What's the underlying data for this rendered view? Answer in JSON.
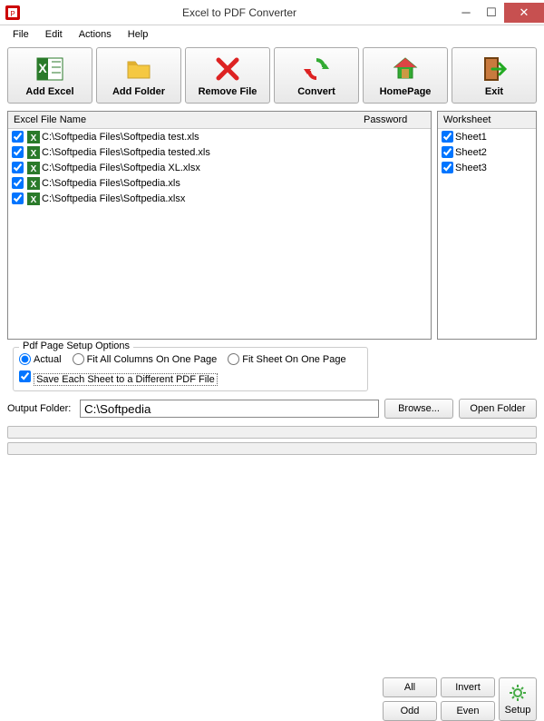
{
  "window": {
    "title": "Excel to PDF Converter"
  },
  "menubar": [
    "File",
    "Edit",
    "Actions",
    "Help"
  ],
  "toolbar": {
    "add_excel": "Add Excel",
    "add_folder": "Add Folder",
    "remove_file": "Remove File",
    "convert": "Convert",
    "homepage": "HomePage",
    "exit": "Exit"
  },
  "file_panel": {
    "header_name": "Excel File Name",
    "header_password": "Password",
    "files": [
      {
        "checked": true,
        "path": "C:\\Softpedia Files\\Softpedia test.xls"
      },
      {
        "checked": true,
        "path": "C:\\Softpedia Files\\Softpedia tested.xls"
      },
      {
        "checked": true,
        "path": "C:\\Softpedia Files\\Softpedia XL.xlsx"
      },
      {
        "checked": true,
        "path": "C:\\Softpedia Files\\Softpedia.xls"
      },
      {
        "checked": true,
        "path": "C:\\Softpedia Files\\Softpedia.xlsx"
      }
    ]
  },
  "worksheet_panel": {
    "header": "Worksheet",
    "sheets": [
      {
        "checked": true,
        "name": "Sheet1"
      },
      {
        "checked": true,
        "name": "Sheet2"
      },
      {
        "checked": true,
        "name": "Sheet3"
      }
    ]
  },
  "pdf_options": {
    "title": "Pdf Page Setup Options",
    "actual": "Actual",
    "fit_cols": "Fit All Columns On One Page",
    "fit_sheet": "Fit Sheet On One Page",
    "save_each": "Save Each Sheet to a Different PDF File",
    "selected": "actual",
    "save_each_checked": true
  },
  "side_buttons": {
    "all": "All",
    "invert": "Invert",
    "odd": "Odd",
    "even": "Even",
    "setup": "Setup"
  },
  "output": {
    "label": "Output Folder:",
    "value": "C:\\Softpedia",
    "browse": "Browse...",
    "open": "Open Folder"
  }
}
